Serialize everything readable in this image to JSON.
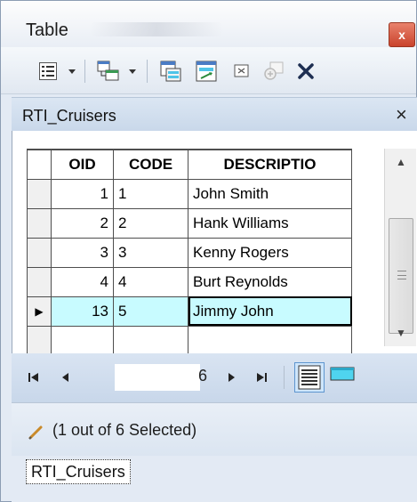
{
  "window": {
    "title": "Table",
    "close_glyph": "x"
  },
  "toolbar": {
    "icons": [
      "table-options-icon",
      "dropdown-arrow-icon",
      "related-tables-icon",
      "dropdown-arrow-icon",
      "select-by-attributes-icon",
      "switch-selection-icon",
      "clear-selection-icon",
      "zoom-to-selected-icon",
      "delete-selected-icon"
    ]
  },
  "subheader": {
    "title": "RTI_Cruisers",
    "close_glyph": "×"
  },
  "grid": {
    "columns": [
      "OID",
      "CODE",
      "DESCRIPTIO"
    ],
    "rows": [
      {
        "oid": "1",
        "code": "1",
        "desc": "John Smith"
      },
      {
        "oid": "2",
        "code": "2",
        "desc": "Hank Williams"
      },
      {
        "oid": "3",
        "code": "3",
        "desc": "Kenny Rogers"
      },
      {
        "oid": "4",
        "code": "4",
        "desc": "Burt Reynolds"
      },
      {
        "oid": "13",
        "code": "5",
        "desc": "Jimmy John"
      }
    ],
    "active_row_marker": "▶",
    "active_row_color": "#c8fbff"
  },
  "navigation": {
    "current_record": "6",
    "first": "I◂",
    "prev": "◂",
    "next": "▸",
    "last": "▸I"
  },
  "status": {
    "text": "(1 out of 6 Selected)"
  },
  "tabs": [
    {
      "label": "RTI_Cruisers"
    }
  ]
}
